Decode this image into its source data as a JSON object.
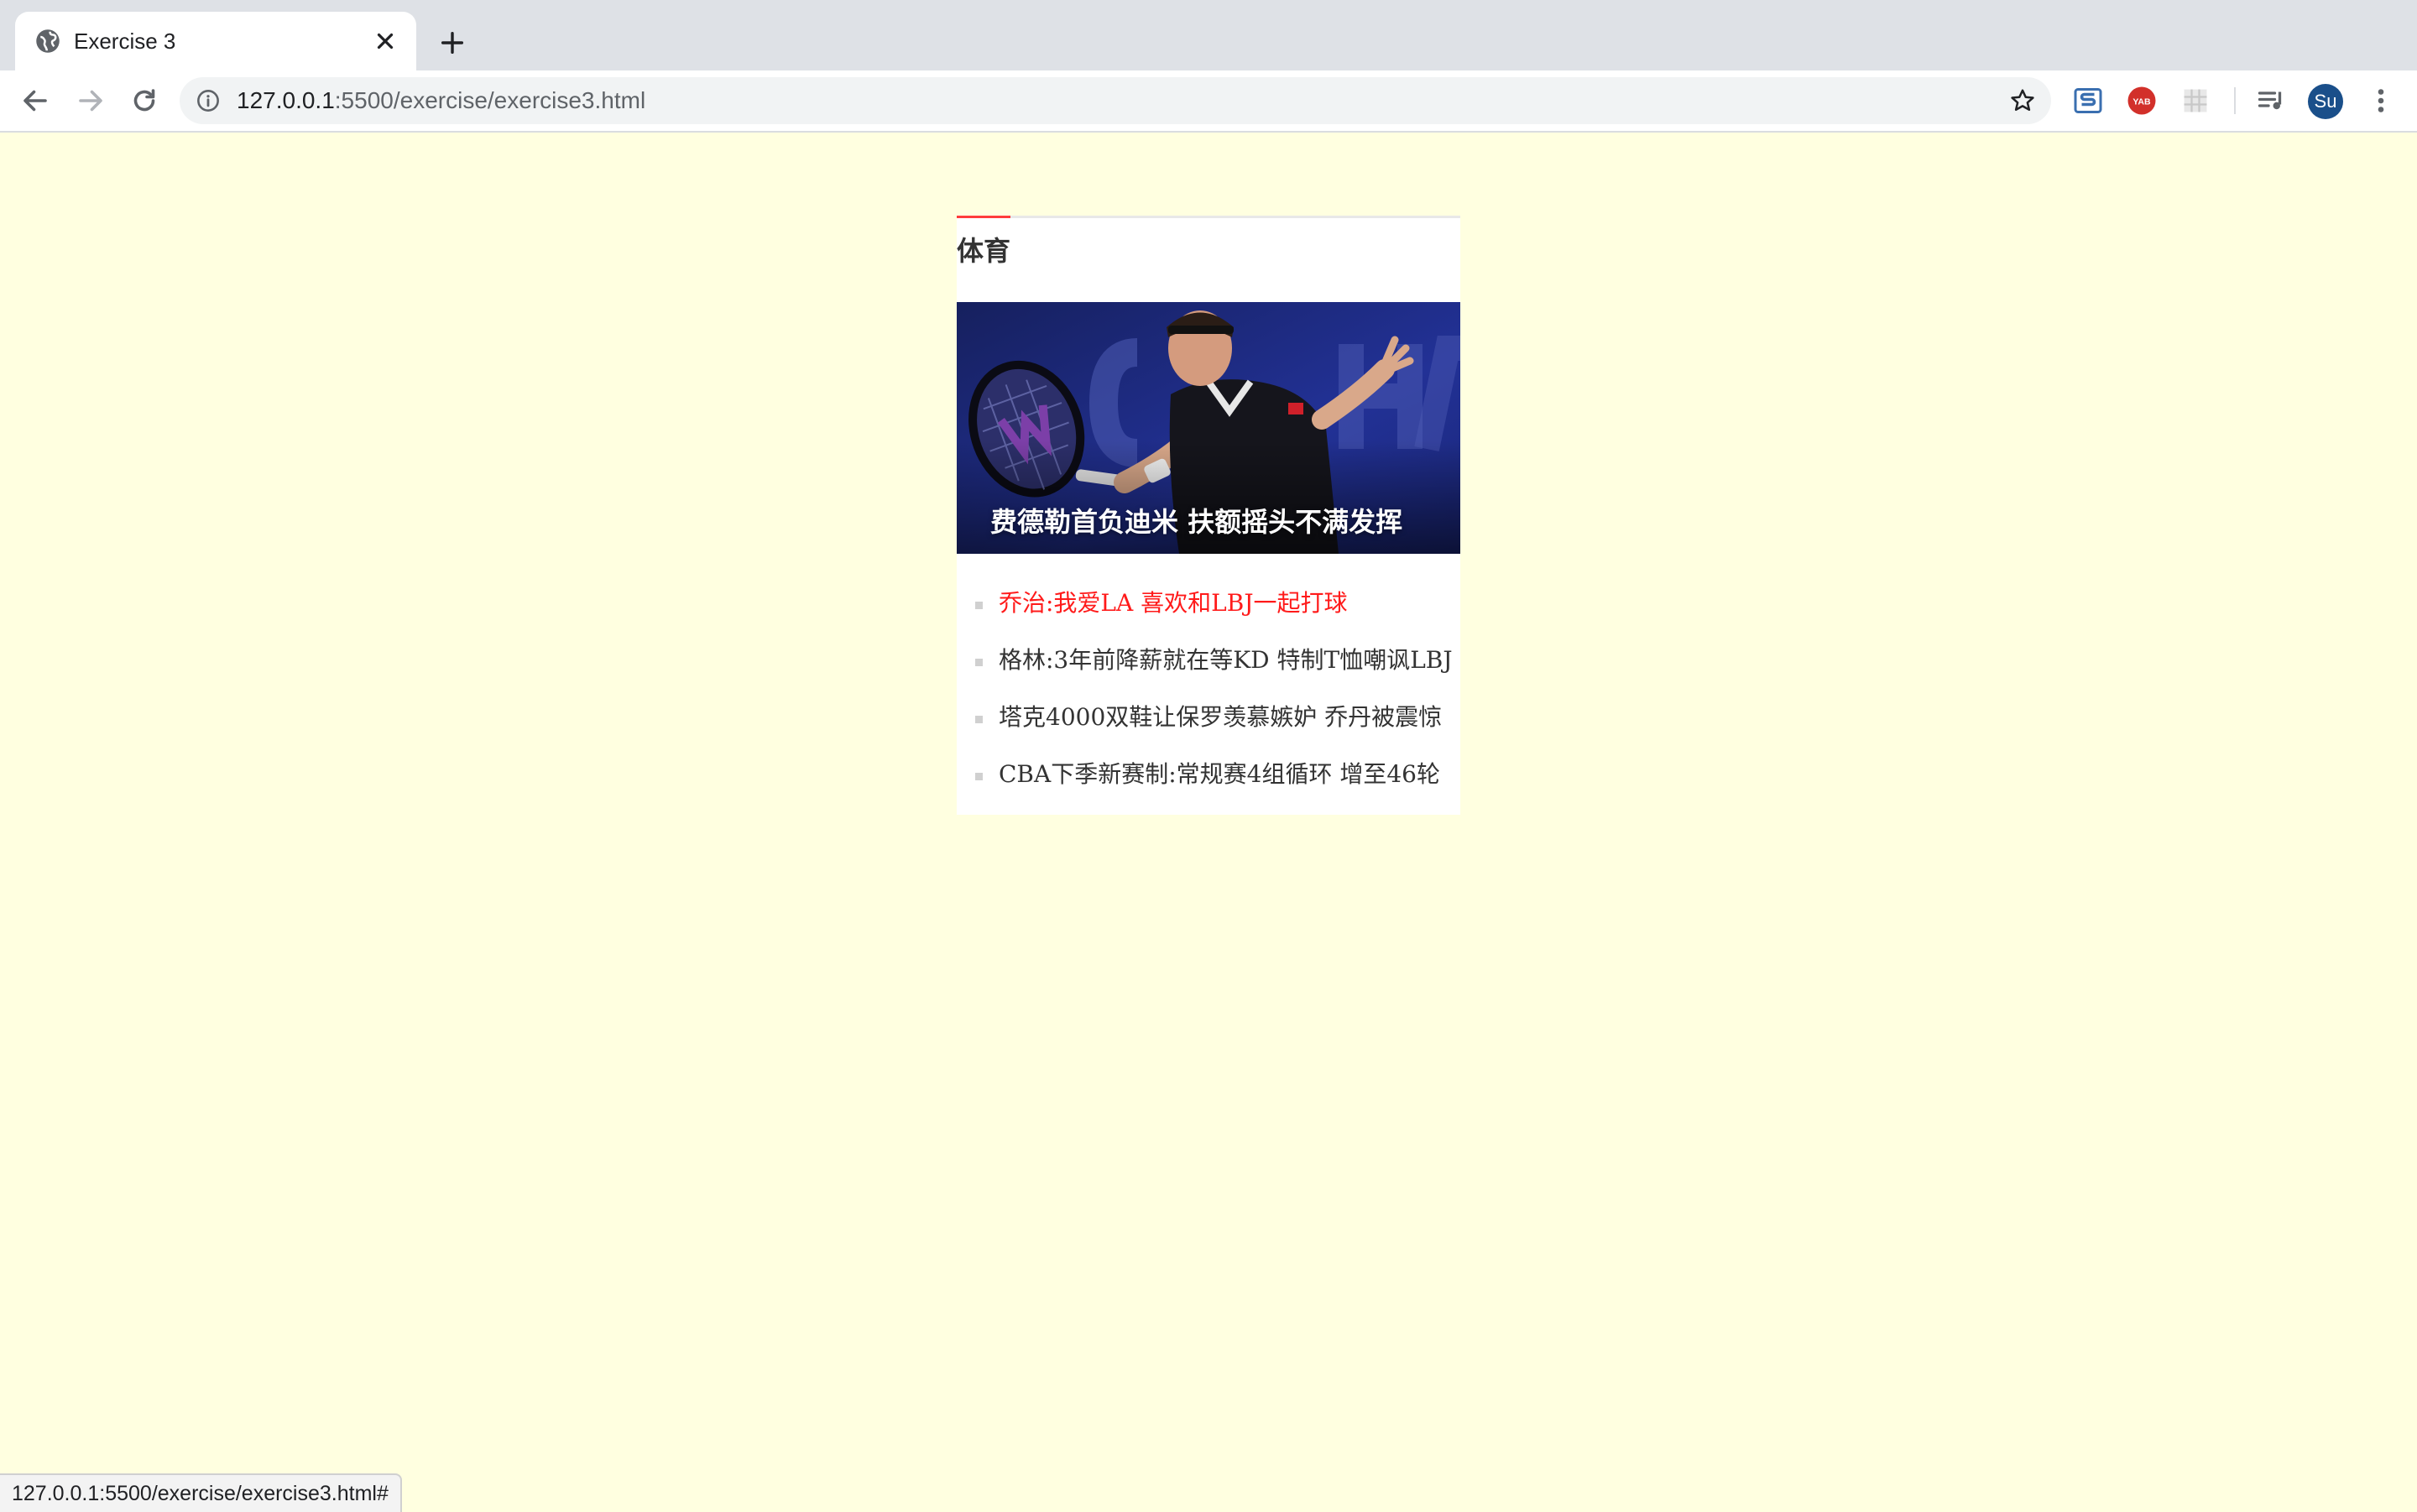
{
  "browser": {
    "tab_title": "Exercise 3",
    "url_host": "127.0.0.1",
    "url_rest": ":5500/exercise/exercise3.html",
    "profile_initials": "Su",
    "extension_badge": "YAB",
    "status_url": "127.0.0.1:5500/exercise/exercise3.html#"
  },
  "news": {
    "heading": "体育",
    "accent_color": "#ff3c3c",
    "photo_caption": "费德勒首负迪米 扶额摇头不满发挥",
    "items": [
      {
        "text": "乔治:我爱LA 喜欢和LBJ一起打球",
        "active": true
      },
      {
        "text": "格林:3年前降薪就在等KD 特制T恤嘲讽LBJ",
        "active": false
      },
      {
        "text": "塔克4000双鞋让保罗羡慕嫉妒 乔丹被震惊",
        "active": false
      },
      {
        "text": "CBA下季新赛制:常规赛4组循环 增至46轮",
        "active": false
      }
    ]
  }
}
